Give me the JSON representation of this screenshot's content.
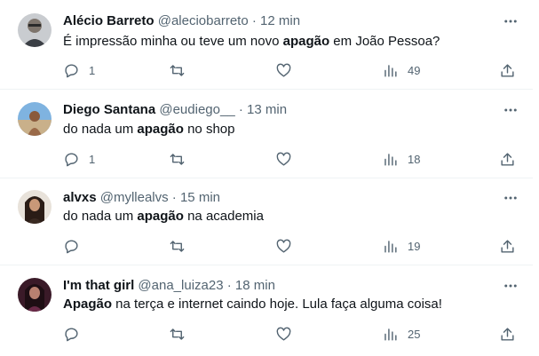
{
  "tweets": [
    {
      "name": "Alécio Barreto",
      "handle": "@aleciobarreto",
      "sep": "·",
      "time": "12 min",
      "text_parts": [
        {
          "t": "É impressão minha ou teve um novo ",
          "bold": false
        },
        {
          "t": "apagão",
          "bold": true
        },
        {
          "t": " em João Pessoa?",
          "bold": false
        }
      ],
      "replies": "1",
      "retweets": "",
      "likes": "",
      "views": "49",
      "avatar_color": "#8a8f96"
    },
    {
      "name": "Diego Santana",
      "handle": "@eudiego__",
      "sep": "·",
      "time": "13 min",
      "text_parts": [
        {
          "t": "do nada um ",
          "bold": false
        },
        {
          "t": "apagão",
          "bold": true
        },
        {
          "t": " no shop",
          "bold": false
        }
      ],
      "replies": "1",
      "retweets": "",
      "likes": "",
      "views": "18",
      "avatar_color": "#5b9bd5"
    },
    {
      "name": "alvxs",
      "handle": "@myllealvs",
      "sep": "·",
      "time": "15 min",
      "text_parts": [
        {
          "t": "do nada um ",
          "bold": false
        },
        {
          "t": "apagão",
          "bold": true
        },
        {
          "t": " na academia",
          "bold": false
        }
      ],
      "replies": "",
      "retweets": "",
      "likes": "",
      "views": "19",
      "avatar_color": "#3a2a22"
    },
    {
      "name": "I'm that girl",
      "handle": "@ana_luiza23",
      "sep": "·",
      "time": "18 min",
      "text_parts": [
        {
          "t": "Apagão",
          "bold": true
        },
        {
          "t": " na terça e internet caindo hoje. Lula faça alguma coisa!",
          "bold": false
        }
      ],
      "replies": "",
      "retweets": "",
      "likes": "",
      "views": "25",
      "avatar_color": "#5a2a3a"
    }
  ],
  "colors": {
    "text": "#0f1419",
    "muted": "#536471",
    "divider": "#eff3f4"
  }
}
